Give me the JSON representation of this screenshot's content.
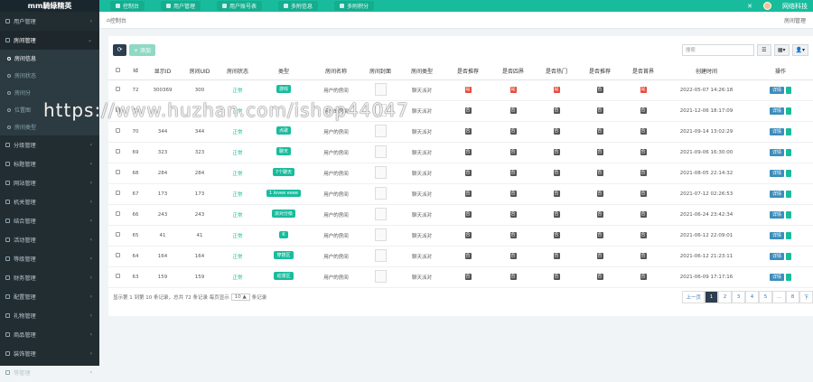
{
  "brand": {
    "logo": "mm騎綠精英"
  },
  "topnav": [
    "控制台",
    "用户管理",
    "用户账号表",
    "多附信息",
    "多附积分"
  ],
  "topright": {
    "user": "网络科技"
  },
  "sidebar": {
    "items": [
      {
        "label": "用户管理",
        "open": false
      },
      {
        "label": "房间管理",
        "open": true
      }
    ],
    "subitems": [
      "房间信息",
      "房间状态",
      "房间分",
      "位置图",
      "房间类型"
    ],
    "more": [
      "分级管理",
      "标题管理",
      "网站管理",
      "机关管理",
      "结合管理",
      "活动管理",
      "等级管理",
      "财务管理",
      "配置管理",
      "礼物管理",
      "商品管理",
      "装饰管理",
      "等管理"
    ]
  },
  "crumb": {
    "left": "控制台",
    "right": "房间管理"
  },
  "toolbar": {
    "add": "+ 添加",
    "search_placeholder": "搜索"
  },
  "columns": [
    "",
    "Id",
    "显示ID",
    "房间UID",
    "房间状态",
    "类型",
    "房间名称",
    "房间封面",
    "房间类型",
    "是否推荐",
    "是否四界",
    "是否热门",
    "是否推荐",
    "是否首界",
    "创建时间",
    "操作"
  ],
  "rows": [
    {
      "id": "72",
      "showid": "300369",
      "uid": "300",
      "status": "正常",
      "tag": "游戏",
      "name": "用户的房间",
      "type": "聊天派对",
      "sw": [
        1,
        1,
        1,
        0,
        1
      ],
      "time": "2022-05-07 14:26:18"
    },
    {
      "id": "71",
      "showid": "",
      "uid": "",
      "status": "正常",
      "tag": "",
      "name": "用户的房间",
      "type": "聊天派对",
      "sw": [
        0,
        0,
        0,
        0,
        0
      ],
      "time": "2021-12-06 18:17:09"
    },
    {
      "id": "70",
      "showid": "344",
      "uid": "344",
      "status": "正常",
      "tag": "点歌",
      "name": "用户的房间",
      "type": "聊天派对",
      "sw": [
        0,
        0,
        0,
        0,
        0
      ],
      "time": "2021-09-14 13:02:29"
    },
    {
      "id": "69",
      "showid": "323",
      "uid": "323",
      "status": "正常",
      "tag": "聊天",
      "name": "用户的房间",
      "type": "聊天派对",
      "sw": [
        0,
        0,
        0,
        0,
        0
      ],
      "time": "2021-09-06 16:30:00"
    },
    {
      "id": "68",
      "showid": "284",
      "uid": "284",
      "status": "正常",
      "tag": "7个聊天",
      "name": "用户的房间",
      "type": "聊天派对",
      "sw": [
        0,
        0,
        0,
        0,
        0
      ],
      "time": "2021-08-05 22:14:32"
    },
    {
      "id": "67",
      "showid": "173",
      "uid": "173",
      "status": "正常",
      "tag": "1 lovee eeee",
      "name": "用户的房间",
      "type": "聊天派对",
      "sw": [
        0,
        0,
        0,
        0,
        0
      ],
      "time": "2021-07-12 02:26:53"
    },
    {
      "id": "66",
      "showid": "243",
      "uid": "243",
      "status": "正常",
      "tag": "派对分级",
      "name": "用户的房间",
      "type": "聊天派对",
      "sw": [
        0,
        0,
        0,
        0,
        0
      ],
      "time": "2021-06-24 23:42:34"
    },
    {
      "id": "65",
      "showid": "41",
      "uid": "41",
      "status": "正常",
      "tag": "K",
      "name": "用户的房间",
      "type": "聊天派对",
      "sw": [
        0,
        0,
        0,
        0,
        0
      ],
      "time": "2021-06-12 22:09:01"
    },
    {
      "id": "64",
      "showid": "164",
      "uid": "164",
      "status": "正常",
      "tag": "穿搭区",
      "name": "用户的房间",
      "type": "聊天派对",
      "sw": [
        0,
        0,
        0,
        0,
        0
      ],
      "time": "2021-06-12 21:23:11"
    },
    {
      "id": "63",
      "showid": "159",
      "uid": "159",
      "status": "正常",
      "tag": "动漫区",
      "name": "用户的房间",
      "type": "聊天派对",
      "sw": [
        0,
        0,
        0,
        0,
        0
      ],
      "time": "2021-06-09 17:17:16"
    }
  ],
  "ops": {
    "edit": "详情"
  },
  "pager": {
    "summary_a": "显示第 1 到第 10 条记录，总共 72 条记录 每页显示",
    "pagesize": "10 ▲",
    "summary_b": "条记录",
    "prev": "上一页",
    "pages": [
      "1",
      "2",
      "3",
      "4",
      "5",
      "...",
      "8"
    ],
    "next": "下"
  },
  "watermark": "https://www.huzhan.com/ishop44047"
}
